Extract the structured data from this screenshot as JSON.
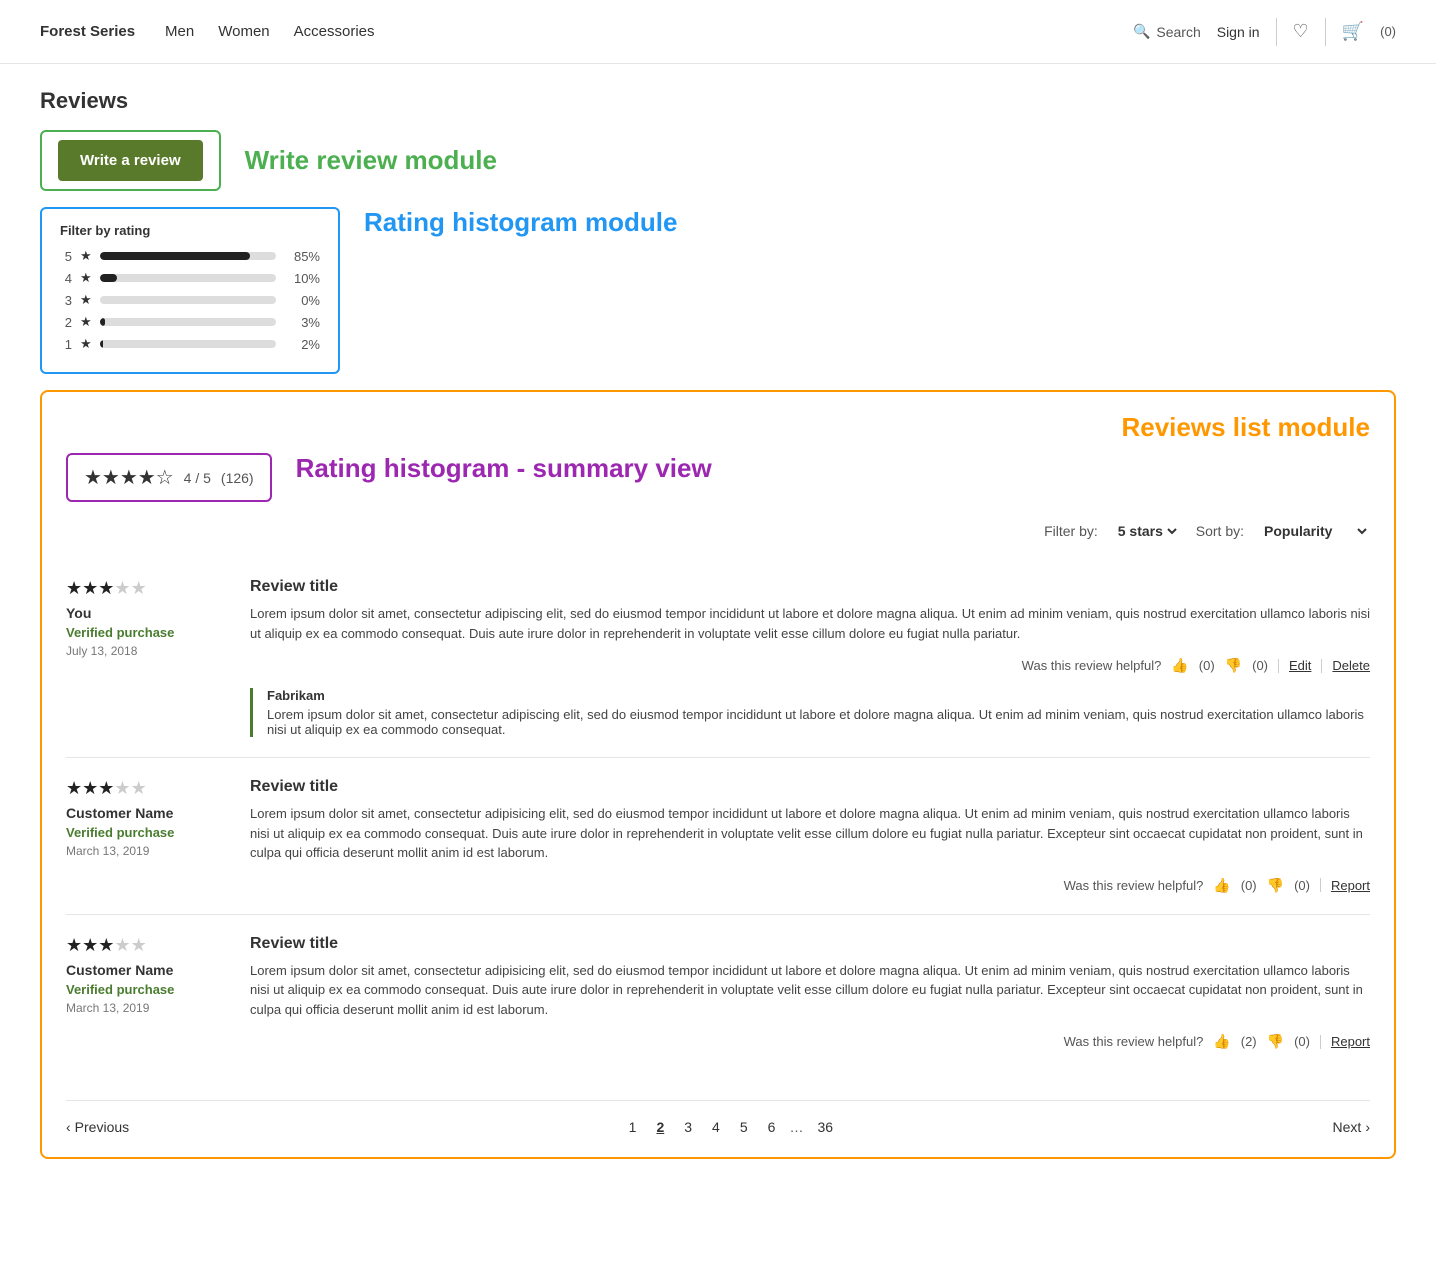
{
  "navbar": {
    "brand": "Forest Series",
    "links": [
      "Men",
      "Women",
      "Accessories"
    ],
    "search_label": "Search",
    "signin_label": "Sign in",
    "cart_count": "(0)"
  },
  "page": {
    "section_title": "Reviews",
    "write_review_label": "Write review module",
    "write_review_btn": "Write a review",
    "histogram_module_label": "Rating histogram module",
    "histogram_title": "Filter by rating",
    "histogram_rows": [
      {
        "star": "5",
        "pct_num": 85,
        "pct_label": "85%"
      },
      {
        "star": "4",
        "pct_num": 10,
        "pct_label": "10%"
      },
      {
        "star": "3",
        "pct_num": 0,
        "pct_label": "0%"
      },
      {
        "star": "2",
        "pct_num": 3,
        "pct_label": "3%"
      },
      {
        "star": "1",
        "pct_num": 2,
        "pct_label": "2%"
      }
    ],
    "summary_label": "Rating histogram - summary view",
    "summary_stars": "★★★★☆",
    "summary_score": "4 / 5",
    "summary_count": "(126)",
    "reviews_list_label": "Reviews list module",
    "filter_label": "Filter by:",
    "filter_value": "5 stars ▾",
    "sort_label": "Sort by:",
    "sort_value": "Popularity ▾",
    "reviews": [
      {
        "stars_filled": 3,
        "stars_empty": 2,
        "reviewer": "You",
        "verified": "Verified purchase",
        "date": "July 13, 2018",
        "title": "Review title",
        "text": "Lorem ipsum dolor sit amet, consectetur adipiscing elit, sed do eiusmod tempor incididunt ut labore et dolore magna aliqua. Ut enim ad minim veniam, quis nostrud exercitation ullamco laboris nisi ut aliquip ex ea commodo consequat. Duis aute irure dolor in reprehenderit in voluptate velit esse cillum dolore eu fugiat nulla pariatur.",
        "helpful_label": "Was this review helpful?",
        "thumbs_up": "(0)",
        "thumbs_down": "(0)",
        "actions": [
          "Edit",
          "Delete"
        ],
        "vendor_response": {
          "name": "Fabrikam",
          "text": "Lorem ipsum dolor sit amet, consectetur adipiscing elit, sed do eiusmod tempor incididunt ut labore et dolore magna aliqua. Ut enim ad minim veniam, quis nostrud exercitation ullamco laboris nisi ut aliquip ex ea commodo consequat."
        }
      },
      {
        "stars_filled": 3,
        "stars_empty": 2,
        "reviewer": "Customer Name",
        "verified": "Verified purchase",
        "date": "March 13, 2019",
        "title": "Review title",
        "text": "Lorem ipsum dolor sit amet, consectetur adipisicing elit, sed do eiusmod tempor incididunt ut labore et dolore magna aliqua. Ut enim ad minim veniam, quis nostrud exercitation ullamco laboris nisi ut aliquip ex ea commodo consequat. Duis aute irure dolor in reprehenderit in voluptate velit esse cillum dolore eu fugiat nulla pariatur. Excepteur sint occaecat cupidatat non proident, sunt in culpa qui officia deserunt mollit anim id est laborum.",
        "helpful_label": "Was this review helpful?",
        "thumbs_up": "(0)",
        "thumbs_down": "(0)",
        "actions": [
          "Report"
        ],
        "vendor_response": null
      },
      {
        "stars_filled": 3,
        "stars_empty": 2,
        "reviewer": "Customer Name",
        "verified": "Verified purchase",
        "date": "March 13, 2019",
        "title": "Review title",
        "text": "Lorem ipsum dolor sit amet, consectetur adipisicing elit, sed do eiusmod tempor incididunt ut labore et dolore magna aliqua. Ut enim ad minim veniam, quis nostrud exercitation ullamco laboris nisi ut aliquip ex ea commodo consequat. Duis aute irure dolor in reprehenderit in voluptate velit esse cillum dolore eu fugiat nulla pariatur. Excepteur sint occaecat cupidatat non proident, sunt in culpa qui officia deserunt mollit anim id est laborum.",
        "helpful_label": "Was this review helpful?",
        "thumbs_up": "(2)",
        "thumbs_down": "(0)",
        "actions": [
          "Report"
        ],
        "vendor_response": null
      }
    ],
    "pagination": {
      "prev_label": "Previous",
      "next_label": "Next",
      "pages": [
        "1",
        "2",
        "3",
        "4",
        "5",
        "6",
        "...",
        "36"
      ],
      "active_page": "2"
    }
  }
}
